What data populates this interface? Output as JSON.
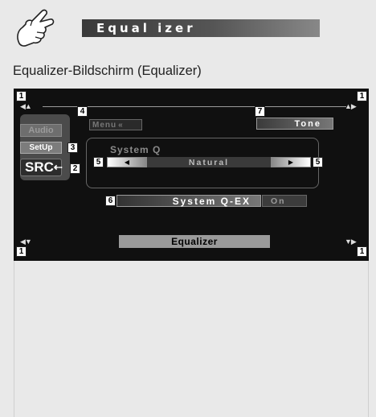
{
  "header": {
    "title": "Equal izer"
  },
  "caption": "Equalizer-Bildschirm (Equalizer)",
  "screen": {
    "side": {
      "audio_label": "Audio",
      "setup_label": "SetUp",
      "src_label": "SRC"
    },
    "menu_label": "Menu",
    "tone_label": "Tone",
    "system_q_label": "System Q",
    "system_q_value": "Natural",
    "system_q_ex_label": "System Q-EX",
    "system_q_ex_value": "On",
    "footer_label": "Equalizer"
  },
  "callouts": {
    "c1": "1",
    "c2": "2",
    "c3": "3",
    "c4": "4",
    "c5": "5",
    "c6": "6",
    "c7": "7"
  },
  "colors": {
    "page_background": "#e9e9e9",
    "screen_background": "#101010",
    "title_bar": "#3a3a3a"
  },
  "icons": [
    "pointing-hand-icon",
    "speaker-left-icon",
    "speaker-right-icon",
    "arrow-left-icon",
    "arrow-right-icon",
    "return-icon"
  ]
}
